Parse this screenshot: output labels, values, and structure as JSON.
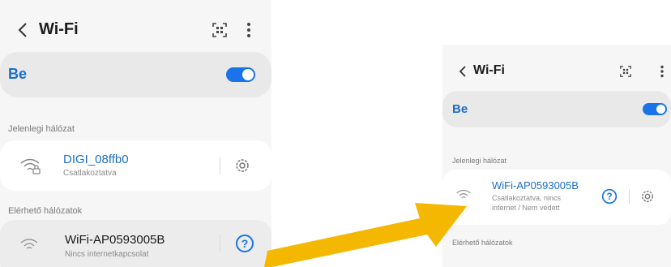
{
  "left": {
    "title": "Wi-Fi",
    "toggle_label": "Be",
    "current_section": "Jelenlegi hálózat",
    "current_network": {
      "ssid": "DIGI_08ffb0",
      "status": "Csatlakoztatva"
    },
    "available_section": "Elérhető hálózatok",
    "available_network": {
      "ssid": "WiFi-AP0593005B",
      "status": "Nincs internetkapcsolat"
    }
  },
  "right": {
    "title": "Wi-Fi",
    "toggle_label": "Be",
    "current_section": "Jelenlegi hálózat",
    "current_network": {
      "ssid": "WiFi-AP0593005B",
      "status_line1": "Csatlakoztatva, nincs",
      "status_line2": "internet / Nem védett"
    },
    "available_section": "Elérhető hálózatok"
  },
  "colors": {
    "accent": "#1a73e8",
    "arrow": "#f5b800",
    "link_text": "#1a6fcb"
  },
  "icons": [
    "back-chevron-icon",
    "qr-scan-icon",
    "more-vert-icon",
    "wifi-icon",
    "wifi-lock-icon",
    "gear-icon",
    "help-icon",
    "arrow-icon"
  ]
}
